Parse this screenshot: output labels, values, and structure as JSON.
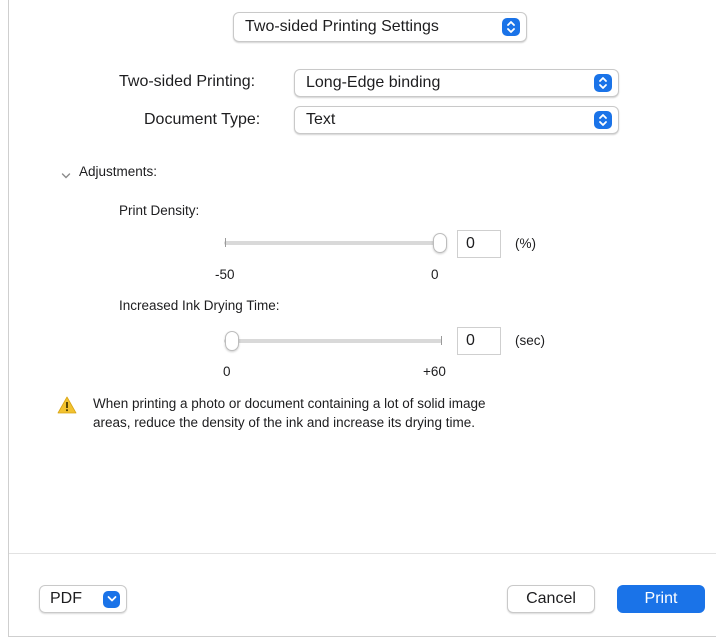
{
  "header": {
    "preset_label": "Two-sided Printing Settings"
  },
  "form": {
    "two_sided_label": "Two-sided Printing:",
    "two_sided_value": "Long-Edge binding",
    "doc_type_label": "Document Type:",
    "doc_type_value": "Text"
  },
  "adjustments": {
    "toggle_label": "Adjustments:",
    "print_density": {
      "label": "Print Density:",
      "value": "0",
      "unit": "(%)",
      "min_label": "-50",
      "max_label": "0",
      "level": 1.0
    },
    "drying_time": {
      "label": "Increased Ink Drying Time:",
      "value": "0",
      "unit": "(sec)",
      "min_label": "0",
      "max_label": "+60",
      "level": 0.0
    }
  },
  "warning": {
    "line1": "When printing a photo or document containing a lot of solid image",
    "line2": "areas, reduce the density of the ink and increase its drying time."
  },
  "footer": {
    "pdf_label": "PDF",
    "cancel_label": "Cancel",
    "print_label": "Print"
  },
  "colors": {
    "accent": "#1a73e8",
    "warning": "#f2c230"
  }
}
